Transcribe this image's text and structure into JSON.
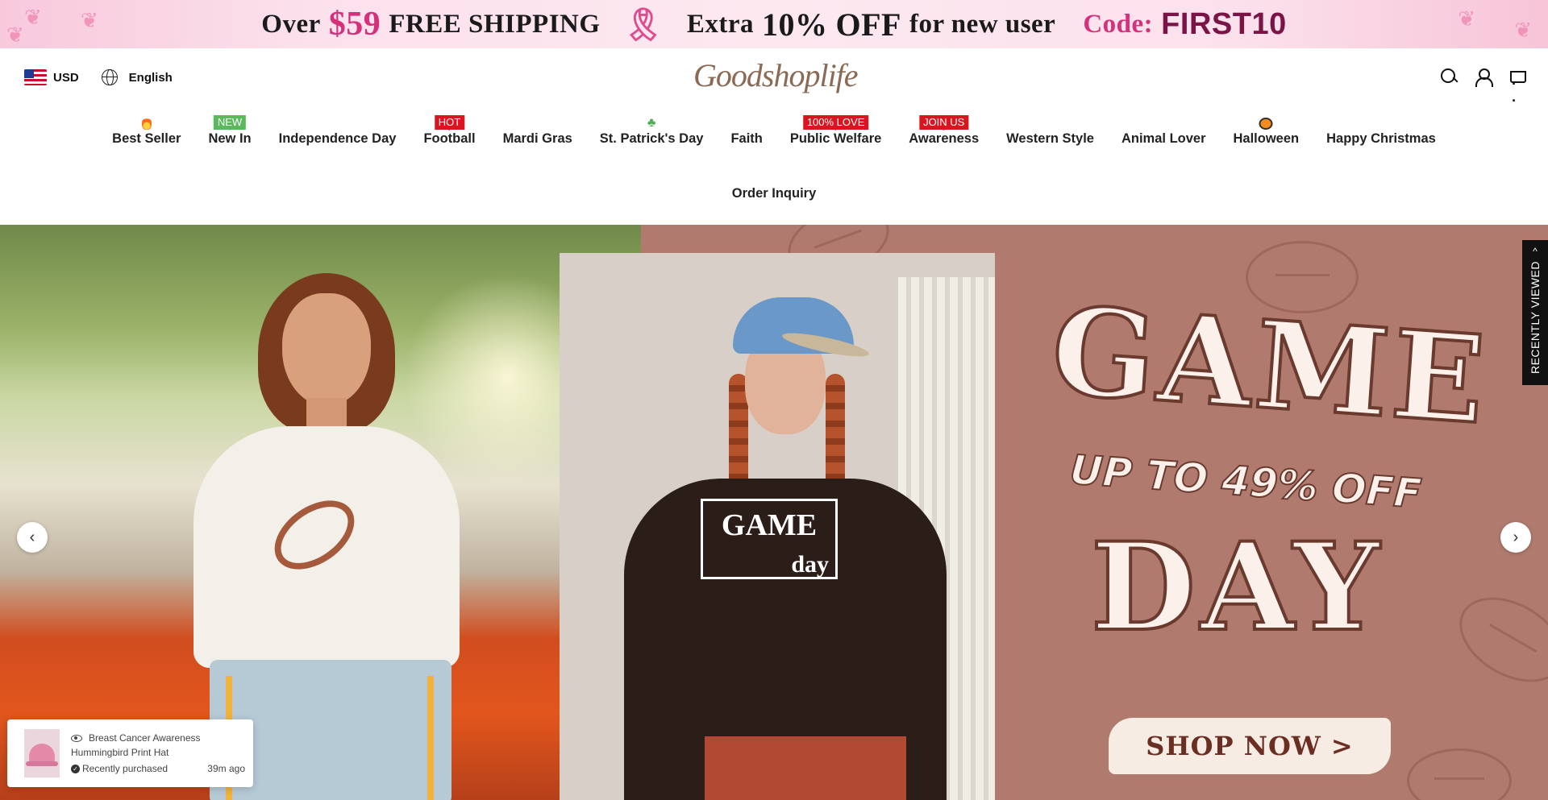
{
  "announcement": {
    "over": "Over",
    "amount": "$59",
    "free_shipping": "FREE SHIPPING",
    "extra": "Extra",
    "percent": "10%",
    "off": "OFF",
    "for_new_user": "for new user",
    "code_label": "Code:",
    "code_value": "FIRST10"
  },
  "header": {
    "currency": "USD",
    "language": "English",
    "logo_text": "Goodshoplife"
  },
  "nav": {
    "items": [
      {
        "label": "Best Seller",
        "badge_type": "flame-icon"
      },
      {
        "label": "New In",
        "badge": "NEW",
        "badge_color": "#5cb85c"
      },
      {
        "label": "Independence Day"
      },
      {
        "label": "Football",
        "badge": "HOT",
        "badge_color": "#d9151f"
      },
      {
        "label": "Mardi Gras"
      },
      {
        "label": "St. Patrick's Day",
        "badge_type": "clover-icon"
      },
      {
        "label": "Faith"
      },
      {
        "label": "Public Welfare",
        "badge": "100% LOVE",
        "badge_color": "#d9151f"
      },
      {
        "label": "Awareness",
        "badge": "JOIN US",
        "badge_color": "#d9151f"
      },
      {
        "label": "Western Style"
      },
      {
        "label": "Animal Lover"
      },
      {
        "label": "Halloween",
        "badge_type": "pumpkin-icon"
      },
      {
        "label": "Happy Christmas"
      }
    ],
    "order_inquiry": "Order Inquiry"
  },
  "hero": {
    "headline_top": "GAME",
    "promo": "UP TO 49% OFF",
    "headline_bottom": "DAY",
    "cta": "SHOP NOW >",
    "shirt_print_main": "GAME",
    "shirt_print_sub": "day",
    "prev_arrow": "‹",
    "next_arrow": "›"
  },
  "recently_viewed": {
    "label": "RECENTLY VIEWED",
    "chevron": "^"
  },
  "purchase_popup": {
    "product_name": "Breast Cancer Awareness Hummingbird Print Hat",
    "status": "Recently purchased",
    "time_ago": "39m ago"
  },
  "colors": {
    "accent_pink": "#d6307a",
    "badge_red": "#d9151f",
    "badge_green": "#5cb85c",
    "hero_bg": "#b07b6e"
  }
}
